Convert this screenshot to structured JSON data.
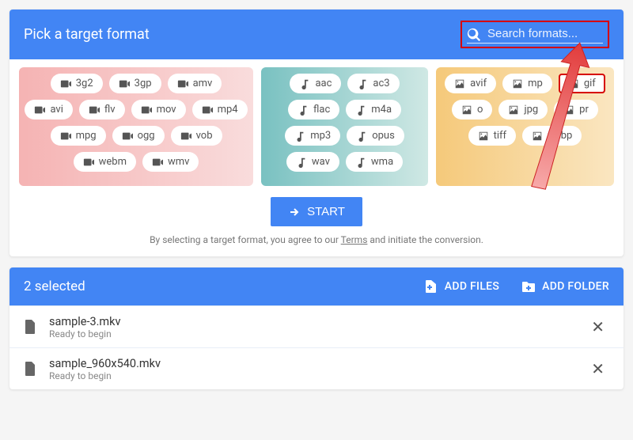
{
  "header": {
    "title": "Pick a target format"
  },
  "search": {
    "placeholder": "Search formats..."
  },
  "groups": {
    "video": [
      "3g2",
      "3gp",
      "amv",
      "avi",
      "flv",
      "mov",
      "mp4",
      "mpg",
      "ogg",
      "vob",
      "webm",
      "wmv"
    ],
    "audio": [
      "aac",
      "ac3",
      "flac",
      "m4a",
      "mp3",
      "opus",
      "wav",
      "wma"
    ],
    "image": [
      "avif",
      "mp",
      "gif",
      "o",
      "jpg",
      "pr",
      "tiff",
      "webp"
    ]
  },
  "highlight_format": "gif",
  "start": {
    "label": "START"
  },
  "terms": {
    "prefix": "By selecting a target format, you agree to our ",
    "link": "Terms",
    "suffix": " and initiate the conversion."
  },
  "filebar": {
    "selected_text": "2 selected",
    "add_files": "ADD FILES",
    "add_folder": "ADD FOLDER"
  },
  "files": [
    {
      "name": "sample-3.mkv",
      "status": "Ready to begin"
    },
    {
      "name": "sample_960x540.mkv",
      "status": "Ready to begin"
    }
  ]
}
